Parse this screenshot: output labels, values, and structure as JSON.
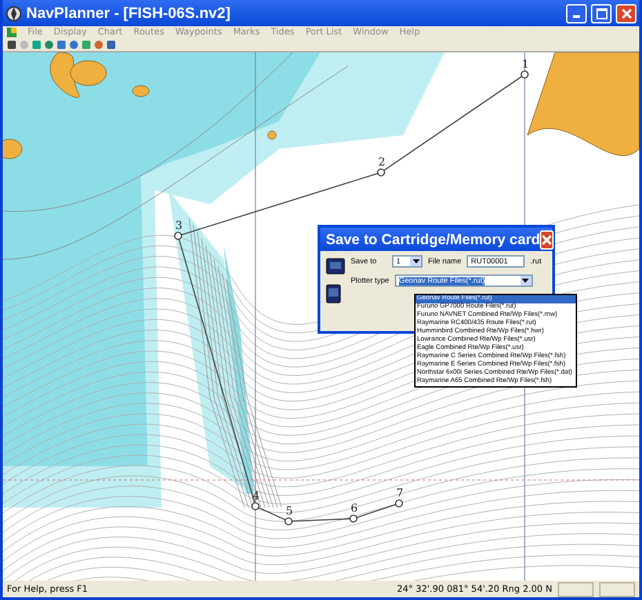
{
  "window": {
    "title": "NavPlanner - [FISH-06S.nv2]"
  },
  "menu": [
    "File",
    "Display",
    "Chart",
    "Routes",
    "Waypoints",
    "Marks",
    "Tides",
    "Port List",
    "Window",
    "Help"
  ],
  "route": {
    "waypoints": [
      "1",
      "2",
      "3",
      "4",
      "5",
      "6",
      "7"
    ]
  },
  "dialog": {
    "title": "Save to Cartridge/Memory card",
    "save_to_label": "Save to",
    "save_to_value": "1",
    "file_name_label": "File name",
    "file_name_value": "RUT00001",
    "file_ext": ".rut",
    "plotter_type_label": "Plotter type",
    "plotter_type_value": "Geonav Route Files(*.rut)",
    "options": [
      {
        "label": "Geonav Route Files(*.rut)",
        "selected": true
      },
      {
        "label": "Furuno GP7000 Route Files(*.rut)",
        "selected": false
      },
      {
        "label": "Furuno NAVNET Combined Rte/Wp Files(*.rnw)",
        "selected": false
      },
      {
        "label": "Raymarine RC400/435 Route Files(*.rut)",
        "selected": false
      },
      {
        "label": "Humminbird Combined Rte/Wp Files(*.hwr)",
        "selected": false
      },
      {
        "label": "Lowrance Combined Rte/Wp Files(*.usr)",
        "selected": false
      },
      {
        "label": "Eagle Combined Rte/Wp Files(*.usr)",
        "selected": false
      },
      {
        "label": "Raymarine C Series Combined Rte/Wp Files(*.fsh)",
        "selected": false
      },
      {
        "label": "Raymarine E Series Combined Rte/Wp Files(*.fsh)",
        "selected": false
      },
      {
        "label": "Northstar 6x00i Series Combined Rte/Wp Files(*.dat)",
        "selected": false
      },
      {
        "label": "Raymarine A65 Combined Rte/Wp Files(*.fsh)",
        "selected": false
      }
    ]
  },
  "status_bar": {
    "help": "For Help, press F1",
    "position": "24° 32'.90 081° 54'.20 Rng 2.00 N"
  }
}
